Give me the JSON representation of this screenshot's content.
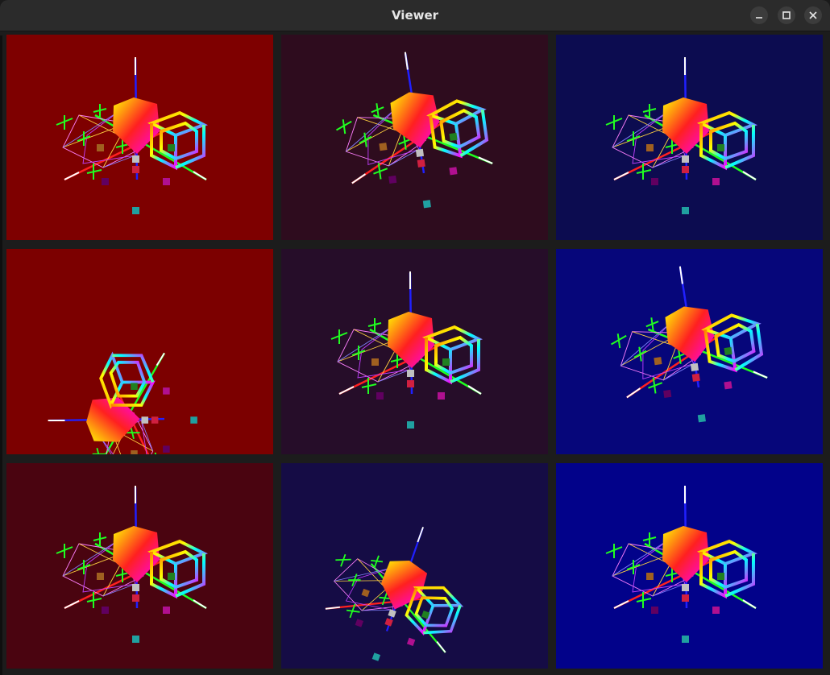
{
  "window": {
    "title": "Viewer"
  },
  "controls": {
    "minimize": "minimize-icon",
    "maximize": "maximize-icon",
    "close": "close-icon"
  },
  "viewports": [
    {
      "id": "r1c1",
      "bg": "#7e0000",
      "variant": "front"
    },
    {
      "id": "r1c2",
      "bg": "#2e0c1e",
      "variant": "tilt"
    },
    {
      "id": "r1c3",
      "bg": "#0c0c50",
      "variant": "front"
    },
    {
      "id": "r2c1",
      "bg": "#7c0000",
      "variant": "side"
    },
    {
      "id": "r2c2",
      "bg": "#260d29",
      "variant": "front"
    },
    {
      "id": "r2c3",
      "bg": "#06067a",
      "variant": "tilt"
    },
    {
      "id": "r3c1",
      "bg": "#4a0410",
      "variant": "front"
    },
    {
      "id": "r3c2",
      "bg": "#150c45",
      "variant": "rot"
    },
    {
      "id": "r3c3",
      "bg": "#02028a",
      "variant": "front"
    }
  ]
}
